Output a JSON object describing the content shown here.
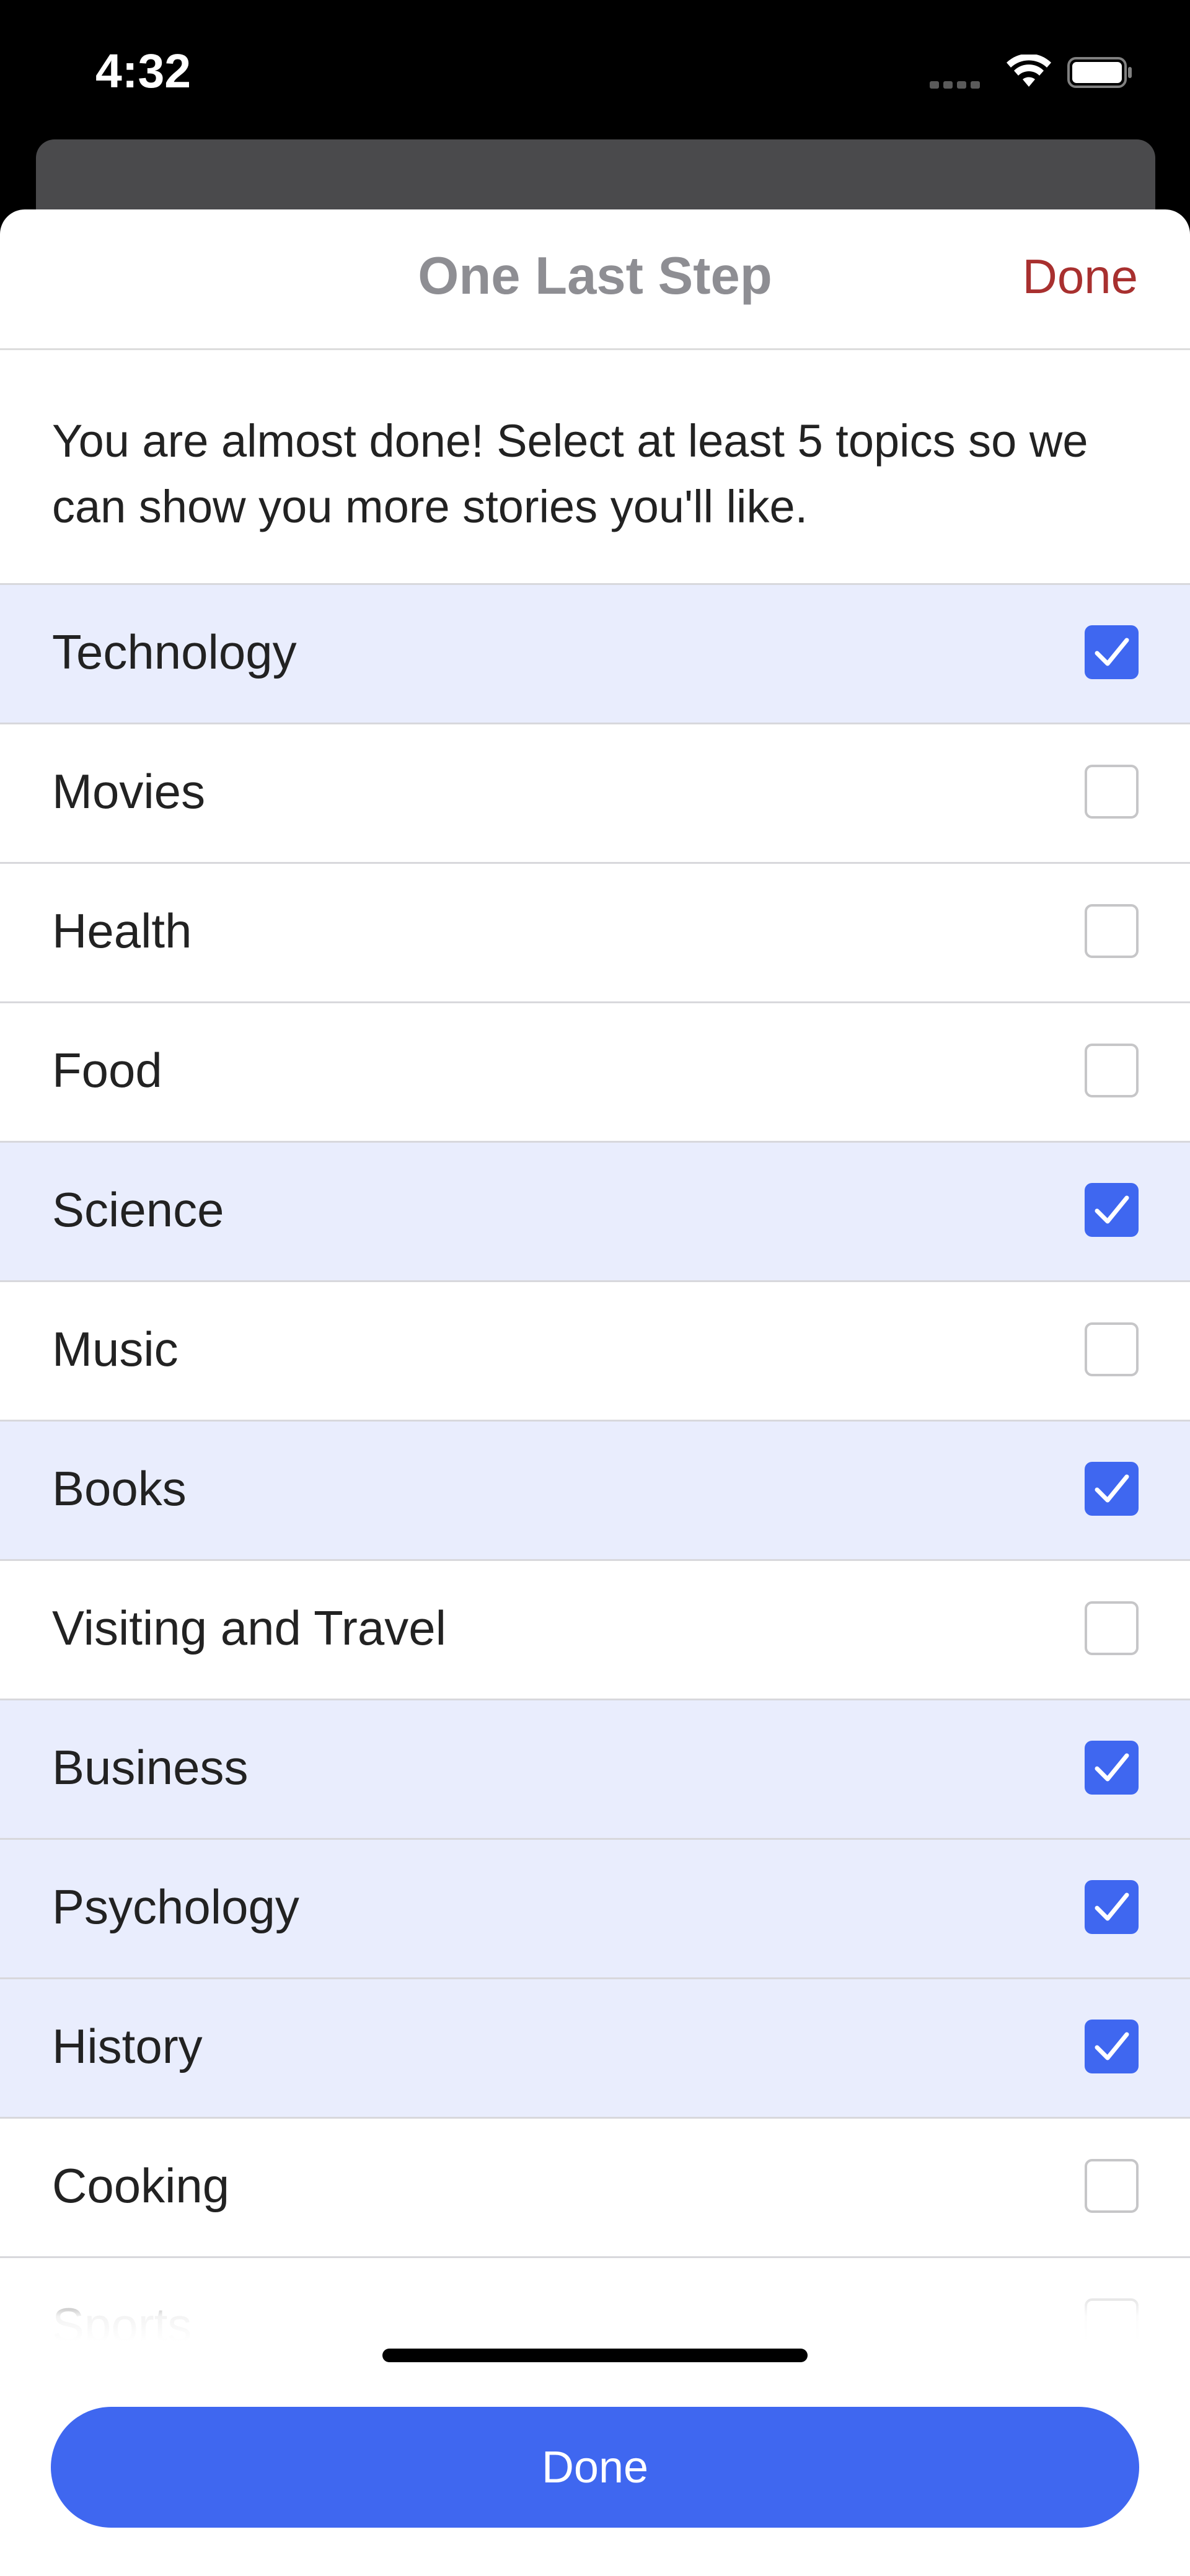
{
  "status_bar": {
    "time": "4:32"
  },
  "sheet": {
    "title": "One Last Step",
    "done_label": "Done",
    "intro": "You are almost done! Select at least 5 topics so we can show you more stories you'll like.",
    "topics": [
      {
        "label": "Technology",
        "selected": true
      },
      {
        "label": "Movies",
        "selected": false
      },
      {
        "label": "Health",
        "selected": false
      },
      {
        "label": "Food",
        "selected": false
      },
      {
        "label": "Science",
        "selected": true
      },
      {
        "label": "Music",
        "selected": false
      },
      {
        "label": "Books",
        "selected": true
      },
      {
        "label": "Visiting and Travel",
        "selected": false
      },
      {
        "label": "Business",
        "selected": true
      },
      {
        "label": "Psychology",
        "selected": true
      },
      {
        "label": "History",
        "selected": true
      },
      {
        "label": "Cooking",
        "selected": false
      },
      {
        "label": "Sports",
        "selected": false
      }
    ],
    "done_button_label": "Done"
  },
  "colors": {
    "accent": "#3f67f0",
    "nav_done": "#a8302f",
    "selected_row": "#e9edfd"
  },
  "icons": {
    "wifi": "wifi-icon",
    "battery": "battery-icon",
    "signal": "cellular-signal-icon",
    "check": "checkmark-icon"
  }
}
